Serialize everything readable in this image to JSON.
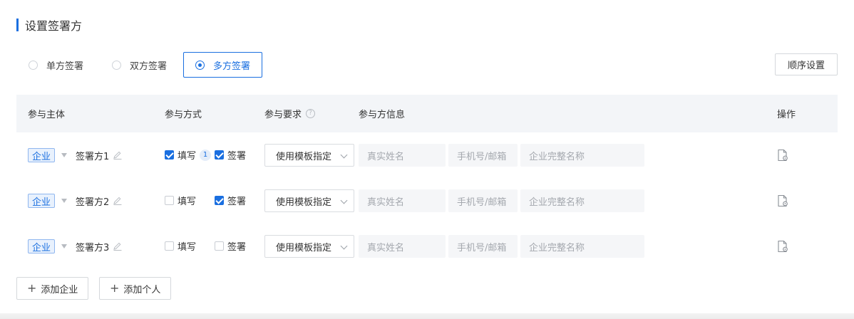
{
  "section": {
    "title": "设置签署方"
  },
  "sign_modes": [
    {
      "label": "单方签署",
      "selected": false
    },
    {
      "label": "双方签署",
      "selected": false
    },
    {
      "label": "多方签署",
      "selected": true
    }
  ],
  "order_button": "顺序设置",
  "table": {
    "headers": {
      "subject": "参与主体",
      "method": "参与方式",
      "requirement": "参与要求",
      "info": "参与方信息",
      "actions": "操作"
    },
    "rows": [
      {
        "entity_type": "企业",
        "party_name": "签署方1",
        "fill": {
          "label": "填写",
          "checked": true,
          "badge": "1"
        },
        "sign": {
          "label": "签署",
          "checked": true
        },
        "requirement": "使用模板指定",
        "name_placeholder": "真实姓名",
        "contact_placeholder": "手机号/邮箱",
        "company_placeholder": "企业完整名称"
      },
      {
        "entity_type": "企业",
        "party_name": "签署方2",
        "fill": {
          "label": "填写",
          "checked": false,
          "badge": ""
        },
        "sign": {
          "label": "签署",
          "checked": true
        },
        "requirement": "使用模板指定",
        "name_placeholder": "真实姓名",
        "contact_placeholder": "手机号/邮箱",
        "company_placeholder": "企业完整名称"
      },
      {
        "entity_type": "企业",
        "party_name": "签署方3",
        "fill": {
          "label": "填写",
          "checked": false,
          "badge": ""
        },
        "sign": {
          "label": "签署",
          "checked": false
        },
        "requirement": "使用模板指定",
        "name_placeholder": "真实姓名",
        "contact_placeholder": "手机号/邮箱",
        "company_placeholder": "企业完整名称"
      }
    ]
  },
  "add_buttons": {
    "company": "添加企业",
    "person": "添加个人"
  },
  "colors": {
    "accent": "#1a6fe0",
    "header_bg": "#f3f5f8",
    "input_bg": "#f5f6f8"
  },
  "icons": {
    "edit": "pencil-icon",
    "action": "document-settings-icon",
    "help": "help-circle-icon",
    "add": "plus-icon"
  }
}
